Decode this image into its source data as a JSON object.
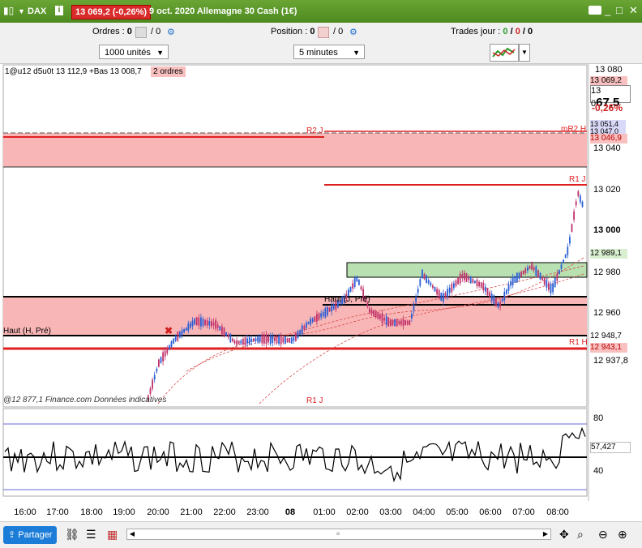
{
  "titlebar": {
    "symbol": "DAX",
    "price_badge": "13 069,2 (-0,26%)",
    "title": "9 oct. 2020 Allemagne 30 Cash (1€)"
  },
  "toolbar": {
    "orders_label": "Ordres : ",
    "orders_count": "0",
    "orders_pending": "/ 0",
    "position_label": "Position : ",
    "position_count": "0",
    "position_pending": "/ 0",
    "trades_label": "Trades jour : ",
    "trades_a": "0",
    "trades_b": "0",
    "trades_c": "0",
    "units_select": "1000 unités",
    "interval_select": "5 minutes"
  },
  "chart_overlay": {
    "info_text": "1@u12 d5u0t 13 112,9 +Bas 13 008,7",
    "orders_badge": "2 ordres",
    "footer_text": "@12 877,1 Finance.com Données indicatives",
    "label_r2": "R2 J",
    "label_mr2": "mR2 H",
    "label_r1j_top": "R1 J",
    "label_haut_j": "Haut (J, Pré)",
    "label_haut_h": "Haut (H, Pré)",
    "label_r1h": "R1 H",
    "label_r1j_bottom": "R1 J"
  },
  "price_axis": {
    "ticks": [
      "13 080",
      "13 040",
      "13 020",
      "13 000",
      "12 980",
      "12 960",
      "12 937,8"
    ],
    "current_small": "13 0",
    "current_big": "67,5",
    "change": "-0,26%",
    "box_13069": "13 069,2",
    "box_13051": "13 051,4",
    "box_13047": "13 047,0",
    "box_13046": "13 046,9",
    "box_12989": "12 989,1",
    "box_12948": "12 948,7",
    "box_12943": "12 943,1"
  },
  "indicator": {
    "ticks": [
      "80",
      "40"
    ],
    "value": "57,427"
  },
  "time_axis": [
    "16:00",
    "17:00",
    "18:00",
    "19:00",
    "20:00",
    "21:00",
    "22:00",
    "23:00",
    "08",
    "01:00",
    "02:00",
    "03:00",
    "04:00",
    "05:00",
    "06:00",
    "07:00",
    "08:00"
  ],
  "bottombar": {
    "share_label": "Partager"
  },
  "colors": {
    "up": "#2a5fd6",
    "down": "#c0326b",
    "resistance_zone": "#f9b6b6",
    "support_zone": "#b8e0b0",
    "red_line": "#e02020",
    "title_green": "#5a9a2a"
  }
}
